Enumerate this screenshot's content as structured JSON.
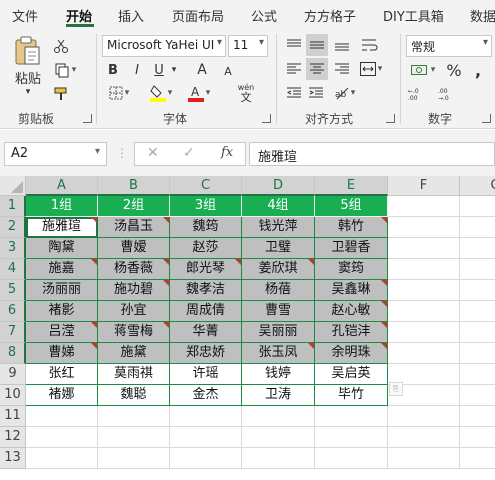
{
  "tabs": [
    "文件",
    "开始",
    "插入",
    "页面布局",
    "公式",
    "方方格子",
    "DIY工具箱",
    "数据"
  ],
  "active_tab": "开始",
  "ribbon": {
    "clipboard": {
      "paste_label": "粘贴",
      "group_label": "剪贴板"
    },
    "font": {
      "font_name": "Microsoft YaHei UI",
      "font_size": "11",
      "bold": "B",
      "italic": "I",
      "underline": "U",
      "grow": "A",
      "shrink": "A",
      "phonetic": "wén",
      "group_label": "字体"
    },
    "alignment": {
      "group_label": "对齐方式"
    },
    "number": {
      "format": "常规",
      "percent": "%",
      "group_label": "数字"
    }
  },
  "formula_bar": {
    "name_box": "A2",
    "cancel": "✕",
    "confirm": "✓",
    "fx": "fx",
    "formula": "施雅瑄"
  },
  "columns": [
    "A",
    "B",
    "C",
    "D",
    "E",
    "F",
    "G"
  ],
  "rows": [
    "1",
    "2",
    "3",
    "4",
    "5",
    "6",
    "7",
    "8",
    "9",
    "10",
    "11",
    "12",
    "13"
  ],
  "sheet": {
    "header": [
      "1组",
      "2组",
      "3组",
      "4组",
      "5组"
    ],
    "data": [
      [
        "施雅瑄",
        "汤昌玉",
        "魏筠",
        "钱光萍",
        "韩竹"
      ],
      [
        "陶黛",
        "曹嫒",
        "赵莎",
        "卫璧",
        "卫碧香"
      ],
      [
        "施嘉",
        "杨香薇",
        "郎光琴",
        "姜欣琪",
        "窦筠"
      ],
      [
        "汤丽丽",
        "施功碧",
        "魏孝洁",
        "杨蓓",
        "吴鑫琳"
      ],
      [
        "褚影",
        "孙宜",
        "周成倩",
        "曹雪",
        "赵心敏"
      ],
      [
        "吕滢",
        "蒋雪梅",
        "华菁",
        "吴丽丽",
        "孔铠沣"
      ],
      [
        "曹娣",
        "施黛",
        "郑忠娇",
        "张玉凤",
        "余明珠"
      ],
      [
        "张红",
        "莫雨祺",
        "许瑶",
        "钱婷",
        "吴启英"
      ],
      [
        "褚娜",
        "魏聪",
        "金杰",
        "卫涛",
        "毕竹"
      ]
    ]
  },
  "colors": {
    "accent": "#217346",
    "header_fill": "#1aae52",
    "gray_fill": "#bfbfbf",
    "comment_mark": "#c0392b"
  }
}
